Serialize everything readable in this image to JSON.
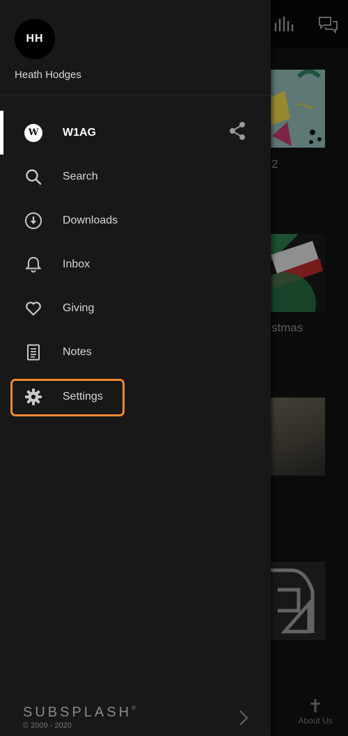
{
  "user": {
    "initials": "HH",
    "name": "Heath Hodges"
  },
  "menu": {
    "items": [
      {
        "label": "W1AG",
        "icon": "w-logo-icon",
        "active": true
      },
      {
        "label": "Search",
        "icon": "search-icon"
      },
      {
        "label": "Downloads",
        "icon": "download-icon"
      },
      {
        "label": "Inbox",
        "icon": "bell-icon"
      },
      {
        "label": "Giving",
        "icon": "heart-icon"
      },
      {
        "label": "Notes",
        "icon": "notes-icon"
      },
      {
        "label": "Settings",
        "icon": "gear-icon",
        "highlighted": true
      }
    ],
    "logo_letter": "W"
  },
  "footer": {
    "brand": "SUBSPLASH",
    "copyright": "© 2009 - 2020"
  },
  "background": {
    "cards": [
      {
        "title_fragment": "2"
      },
      {
        "title_fragment": "stmas"
      },
      {
        "title_fragment": ""
      },
      {
        "title_fragment": ""
      }
    ],
    "tab_label": "About Us"
  },
  "colors": {
    "highlight": "#f08a2c",
    "drawer": "#181818",
    "active_bar": "#ffffff"
  }
}
